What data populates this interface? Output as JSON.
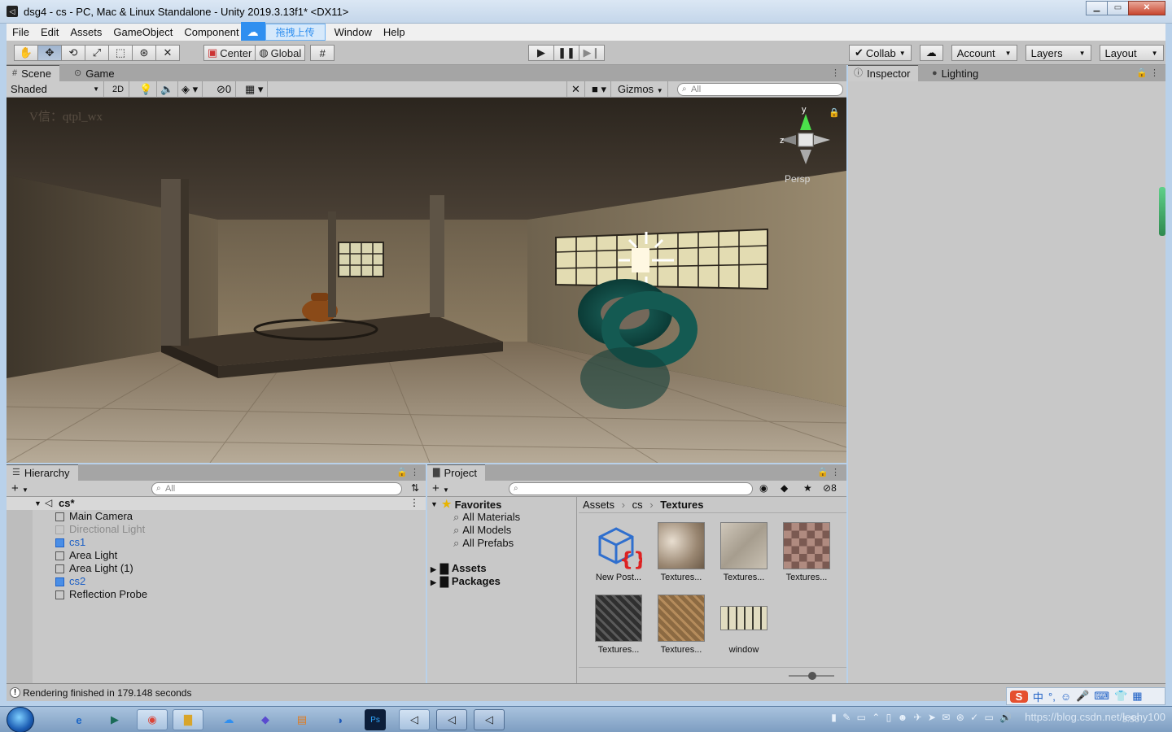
{
  "window": {
    "title": "dsg4 - cs - PC, Mac & Linux Standalone - Unity 2019.3.13f1* <DX11>",
    "icon": "unity-icon",
    "controls": [
      "minimize",
      "maximize",
      "close"
    ]
  },
  "menu": {
    "items": [
      "File",
      "Edit",
      "Assets",
      "GameObject",
      "Component",
      "Window",
      "Help"
    ],
    "overlay_label": "拖拽上传"
  },
  "toolbar": {
    "pivot_label": "Center",
    "space_label": "Global",
    "collab_label": "Collab",
    "account_label": "Account",
    "layers_label": "Layers",
    "layout_label": "Layout"
  },
  "scene": {
    "tabs": [
      "Scene",
      "Game"
    ],
    "shading_mode": "Shaded",
    "mode_2d": "2D",
    "hidden_count": "0",
    "gizmos_label": "Gizmos",
    "search_placeholder": "All",
    "gizmo": {
      "y_label": "y",
      "z_label": "z",
      "projection": "Persp"
    },
    "watermark": "V信：qtpl_wx"
  },
  "inspector": {
    "tabs": [
      "Inspector",
      "Lighting"
    ]
  },
  "hierarchy": {
    "tab": "Hierarchy",
    "search_placeholder": "All",
    "root": "cs*",
    "items": [
      {
        "name": "Main Camera",
        "style": "normal"
      },
      {
        "name": "Directional Light",
        "style": "disabled"
      },
      {
        "name": "cs1",
        "style": "prefab"
      },
      {
        "name": "Area Light",
        "style": "normal"
      },
      {
        "name": "Area Light (1)",
        "style": "normal"
      },
      {
        "name": "cs2",
        "style": "prefab"
      },
      {
        "name": "Reflection Probe",
        "style": "normal"
      }
    ]
  },
  "project": {
    "tab": "Project",
    "hidden_count": "8",
    "favorites_label": "Favorites",
    "favorites": [
      "All Materials",
      "All Models",
      "All Prefabs"
    ],
    "folders": [
      "Assets",
      "Packages"
    ],
    "breadcrumb": [
      "Assets",
      "cs",
      "Textures"
    ],
    "assets": [
      {
        "name": "New Post...",
        "kind": "post"
      },
      {
        "name": "Textures...",
        "kind": "tex1"
      },
      {
        "name": "Textures...",
        "kind": "tex2"
      },
      {
        "name": "Textures...",
        "kind": "tex3"
      },
      {
        "name": "Textures...",
        "kind": "tex4"
      },
      {
        "name": "Textures...",
        "kind": "tex5"
      },
      {
        "name": "window",
        "kind": "window"
      }
    ]
  },
  "status": {
    "message": "Rendering finished in 179.148 seconds"
  },
  "taskbar": {
    "tray_text": "https://blog.csdn.net/leehy100",
    "clock": "3:56",
    "ime_label": "中"
  }
}
